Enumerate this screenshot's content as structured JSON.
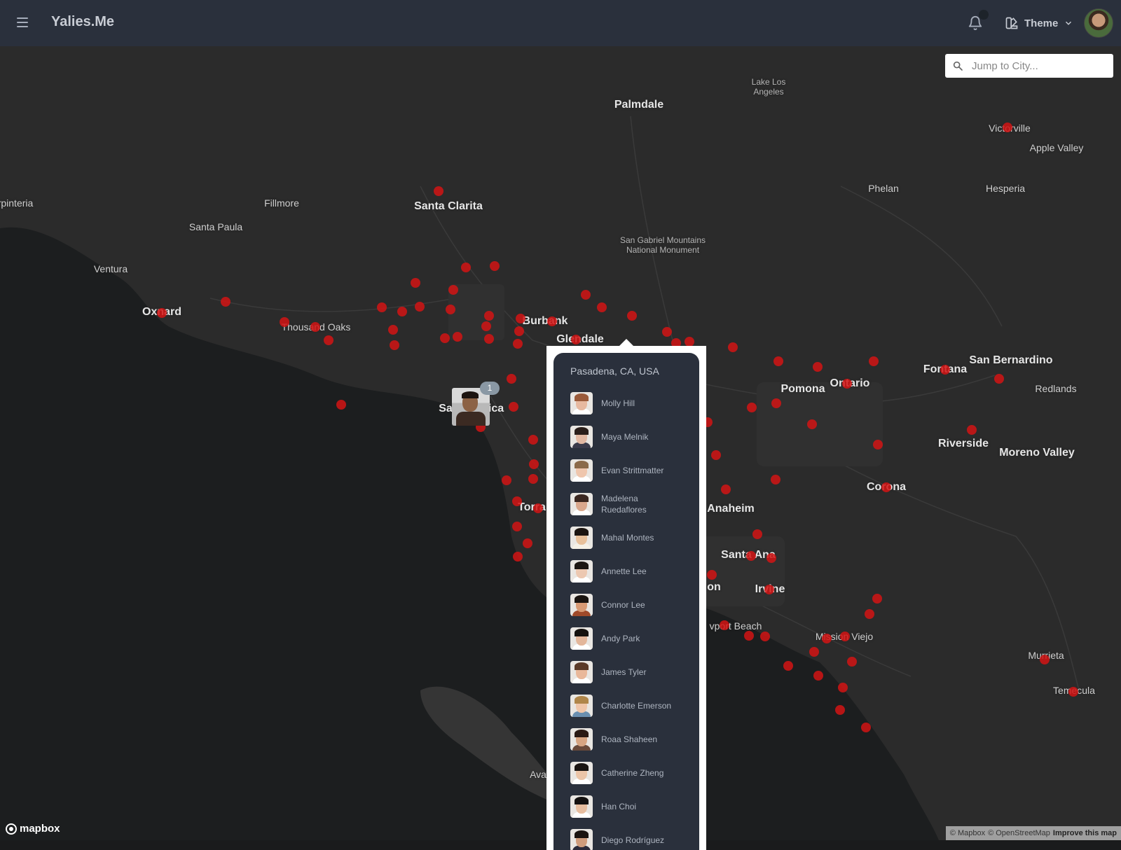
{
  "app": {
    "brand": "Yalies.Me",
    "theme_label": "Theme"
  },
  "search": {
    "placeholder": "Jump to City..."
  },
  "map": {
    "cities": [
      {
        "name": "Palmdale",
        "size": "big"
      },
      {
        "name": "Lake Los Angeles",
        "size": "small"
      },
      {
        "name": "Victorville",
        "size": "normal"
      },
      {
        "name": "Apple Valley",
        "size": "normal"
      },
      {
        "name": "Phelan",
        "size": "normal"
      },
      {
        "name": "Hesperia",
        "size": "normal"
      },
      {
        "name": "rpinteria",
        "size": "normal"
      },
      {
        "name": "Fillmore",
        "size": "normal"
      },
      {
        "name": "Santa Clarita",
        "size": "big"
      },
      {
        "name": "Santa Paula",
        "size": "normal"
      },
      {
        "name": "San Gabriel Mountains National Monument",
        "size": "small"
      },
      {
        "name": "Ventura",
        "size": "normal"
      },
      {
        "name": "Oxnard",
        "size": "big"
      },
      {
        "name": "Thousand Oaks",
        "size": "normal"
      },
      {
        "name": "Burbank",
        "size": "big"
      },
      {
        "name": "Glendale",
        "size": "big"
      },
      {
        "name": "Sa",
        "size": "big"
      },
      {
        "name": "ica",
        "size": "big"
      },
      {
        "name": "Torra",
        "size": "big"
      },
      {
        "name": "Pomona",
        "size": "big"
      },
      {
        "name": "Ontario",
        "size": "big"
      },
      {
        "name": "Fontana",
        "size": "big"
      },
      {
        "name": "San Bernardino",
        "size": "big"
      },
      {
        "name": "Redlands",
        "size": "normal"
      },
      {
        "name": "Riverside",
        "size": "big"
      },
      {
        "name": "Moreno Valley",
        "size": "big"
      },
      {
        "name": "Corona",
        "size": "big"
      },
      {
        "name": "Anaheim",
        "size": "big"
      },
      {
        "name": "Santa Ana",
        "size": "big"
      },
      {
        "name": "on",
        "size": "big"
      },
      {
        "name": "Irvine",
        "size": "big"
      },
      {
        "name": "vport Beach",
        "size": "normal"
      },
      {
        "name": "Mission Viejo",
        "size": "normal"
      },
      {
        "name": "Murrieta",
        "size": "normal"
      },
      {
        "name": "Temecula",
        "size": "normal"
      },
      {
        "name": "Ava",
        "size": "normal"
      }
    ],
    "cluster_count": "1",
    "marker_color": "#d21414"
  },
  "popup": {
    "location": "Pasadena, CA, USA",
    "people": [
      {
        "name": "Molly Hill",
        "skin": "#e7b9a0",
        "hair": "#9a5a3a",
        "shirt": "#ffffff"
      },
      {
        "name": "Maya Melnik",
        "skin": "#e2b8a2",
        "hair": "#2a1e1a",
        "shirt": "#3a3a4a"
      },
      {
        "name": "Evan Strittmatter",
        "skin": "#efc6ad",
        "hair": "#8b6a4a",
        "shirt": "#ffffff"
      },
      {
        "name": "Madelena Ruedaflores",
        "skin": "#d9a78c",
        "hair": "#3b2720",
        "shirt": "#ffffff"
      },
      {
        "name": "Mahal Montes",
        "skin": "#e8c09a",
        "hair": "#1b1410",
        "shirt": "#f5f0e6"
      },
      {
        "name": "Annette Lee",
        "skin": "#ecc8b1",
        "hair": "#1c1612",
        "shirt": "#ffffff"
      },
      {
        "name": "Connor Lee",
        "skin": "#d89a74",
        "hair": "#1a1410",
        "shirt": "#a04a2a"
      },
      {
        "name": "Andy Park",
        "skin": "#e3b69a",
        "hair": "#15110e",
        "shirt": "#ffffff"
      },
      {
        "name": "James Tyler",
        "skin": "#e9b89a",
        "hair": "#5a3a28",
        "shirt": "#ffffff"
      },
      {
        "name": "Charlotte Emerson",
        "skin": "#f0c6aa",
        "hair": "#b0864a",
        "shirt": "#6a8fb0"
      },
      {
        "name": "Roaa Shaheen",
        "skin": "#d7a582",
        "hair": "#2a1a14",
        "shirt": "#6a4a3a"
      },
      {
        "name": "Catherine Zheng",
        "skin": "#ecc5a8",
        "hair": "#1a1411",
        "shirt": "#ffffff"
      },
      {
        "name": "Han Choi",
        "skin": "#e7bd9f",
        "hair": "#141110",
        "shirt": "#ffffff"
      },
      {
        "name": "Diego Rodríguez",
        "skin": "#cf9c7c",
        "hair": "#1b1410",
        "shirt": "#2a2a3a"
      }
    ]
  },
  "footer": {
    "logo_text": "mapbox",
    "attr_mapbox": "© Mapbox",
    "attr_osm": "© OpenStreetMap",
    "attr_improve": "Improve this map"
  },
  "icons": {
    "menu": "hamburger-menu-icon",
    "bell": "bell-icon",
    "theme": "swatch-icon",
    "chevron": "chevron-down-icon",
    "search": "search-icon"
  }
}
